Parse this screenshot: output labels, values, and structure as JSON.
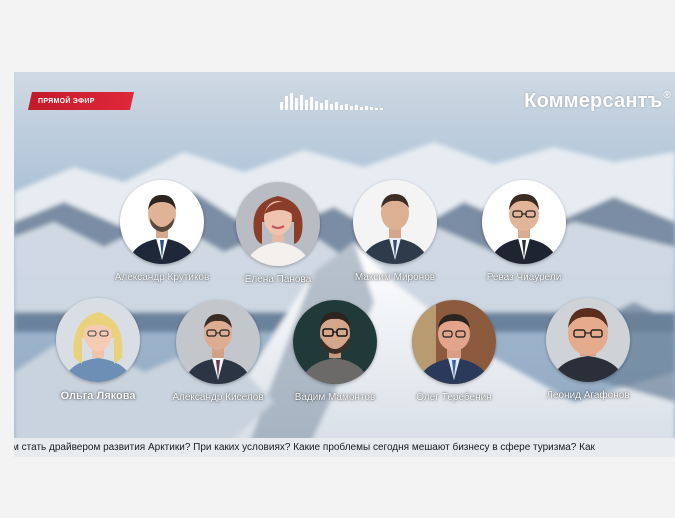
{
  "stream": {
    "live_badge": "ПРЯМОЙ ЭФИР",
    "brand": "Коммерсантъ",
    "brand_sign": "®",
    "ticker": "м стать драйвером развития Арктики? При каких условиях? Какие проблемы сегодня мешают бизнесу в сфере туризма? Как"
  },
  "speakers": {
    "row1": [
      {
        "name": "Александр Крутиков"
      },
      {
        "name": "Елена Панова"
      },
      {
        "name": "Максим Миронов"
      },
      {
        "name": "Реваз Чиаурели"
      }
    ],
    "row2": [
      {
        "name": "Ольга Лякова"
      },
      {
        "name": "Александр Киселов"
      },
      {
        "name": "Вадим Мамонтов"
      },
      {
        "name": "Олег Теребенин"
      },
      {
        "name": "Леонид Агафонов"
      }
    ]
  },
  "colors": {
    "live_badge": "#d3202f",
    "ticker_bg": "#e9ecef",
    "sky": "#a9c0d6"
  }
}
